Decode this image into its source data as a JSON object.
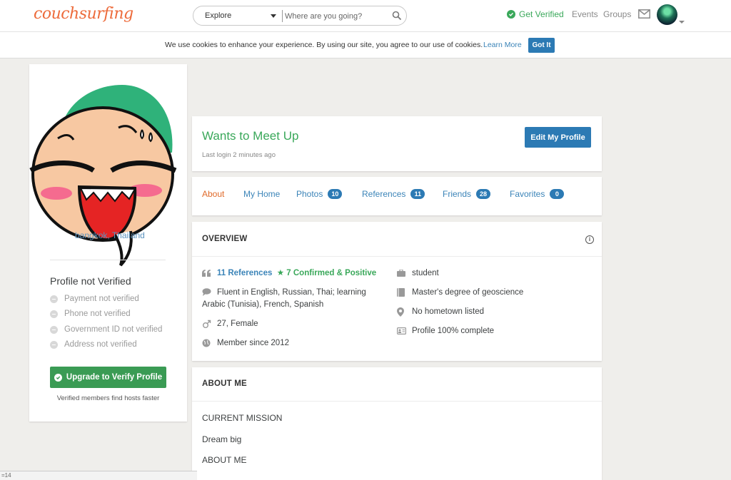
{
  "header": {
    "logo": "couchsurfing",
    "explore_label": "Explore",
    "search_placeholder": "Where are you going?",
    "get_verified": "Get Verified",
    "events": "Events",
    "groups": "Groups"
  },
  "cookie": {
    "message": "We use cookies to enhance your experience. By using our site, you agree to our use of cookies.",
    "learn_more": "Learn More",
    "got_it": "Got It"
  },
  "sidebar": {
    "location": "bangkok, Thailand",
    "verify_title": "Profile not Verified",
    "items": [
      "Payment not verified",
      "Phone not verified",
      "Government ID not verified",
      "Address not verified"
    ],
    "upgrade_label": "Upgrade to Verify Profile",
    "upgrade_note": "Verified members find hosts faster"
  },
  "status_panel": {
    "title": "Wants to Meet Up",
    "last_login": "Last login 2 minutes ago",
    "edit_label": "Edit My Profile"
  },
  "tabs": [
    {
      "label": "About",
      "count": null
    },
    {
      "label": "My Home",
      "count": null
    },
    {
      "label": "Photos",
      "count": "10"
    },
    {
      "label": "References",
      "count": "11"
    },
    {
      "label": "Friends",
      "count": "28"
    },
    {
      "label": "Favorites",
      "count": "0"
    }
  ],
  "overview": {
    "heading": "OVERVIEW",
    "references": "11 References",
    "confirmed": "7 Confirmed & Positive",
    "languages_line1": "Fluent in English, Russian, Thai; learning",
    "languages_line2": "Arabic (Tunisia), French, Spanish",
    "age_gender": "27, Female",
    "member_since": "Member since 2012",
    "occupation": "student",
    "education": "Master's degree of geoscience",
    "hometown": "No hometown listed",
    "profile_complete": "Profile 100% complete"
  },
  "about": {
    "heading": "ABOUT ME",
    "mission_heading": "CURRENT MISSION",
    "mission": "Dream big",
    "about_heading": "ABOUT ME"
  },
  "statusbar": {
    "text": "=14"
  },
  "colors": {
    "brand": "#ed6b3b",
    "link": "#3b84b8",
    "green": "#3aa85a",
    "primary_button": "#2c7ab4",
    "background": "#efeeeb"
  }
}
